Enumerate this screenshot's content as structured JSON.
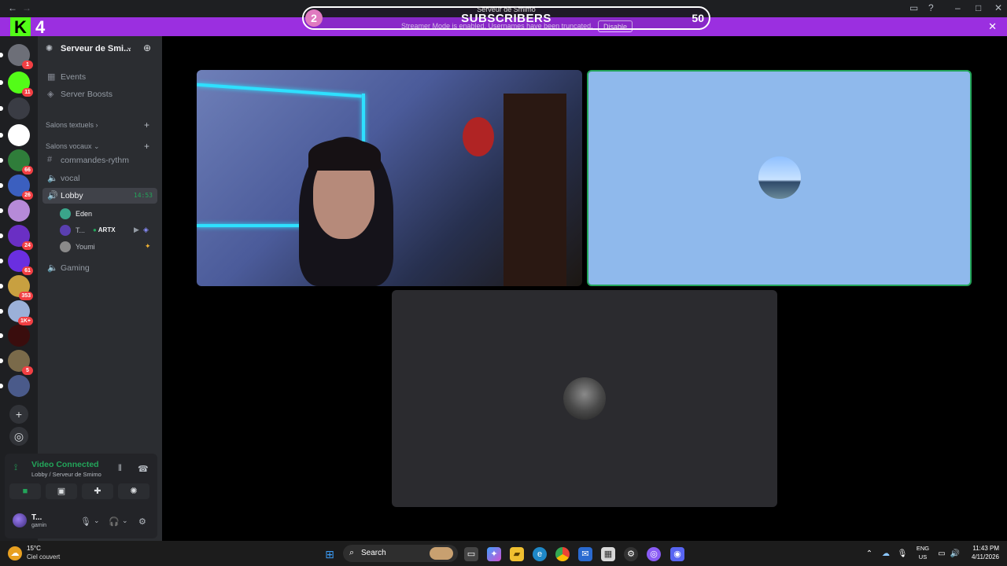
{
  "window": {
    "back_icon": "arrow-left-icon",
    "forward_icon": "arrow-right-icon"
  },
  "overlay": {
    "left_count": "2",
    "title": "SUBSCRIBERS",
    "server": "Serveur de Smimo",
    "right_count": "50"
  },
  "kick": {
    "logo": "K",
    "count": "4"
  },
  "banner": {
    "message": "Streamer Mode is enabled. Usernames have been truncated.",
    "disable": "Disable"
  },
  "servers": [
    {
      "badge": "1",
      "color": "#6d6f78"
    },
    {
      "badge": "11",
      "color": "#53fc18"
    },
    {
      "badge": "",
      "color": "#3a3c44"
    },
    {
      "badge": "",
      "color": "#ffffff"
    },
    {
      "badge": "66",
      "color": "#2f7d3a"
    },
    {
      "badge": "26",
      "color": "#3b5fbf"
    },
    {
      "badge": "",
      "color": "#b68ad8"
    },
    {
      "badge": "24",
      "color": "#6a2fc4"
    },
    {
      "badge": "61",
      "color": "#6a2fe0"
    },
    {
      "badge": "353",
      "color": "#c8a040"
    },
    {
      "badge": "1K+",
      "color": "#9bb0d8"
    },
    {
      "badge": "",
      "color": "#3a0d0d"
    },
    {
      "badge": "5",
      "color": "#7a6a4a"
    },
    {
      "badge": "",
      "color": "#4a5a8a"
    }
  ],
  "server_header": {
    "name": "Serveur de Smi..."
  },
  "channels": {
    "events": "Events",
    "boosts": "Server Boosts",
    "cat_text": "Salons textuels",
    "cat_voice": "Salons vocaux",
    "items": [
      {
        "label": "commandes-rythm",
        "icon": "#"
      },
      {
        "label": "vocal",
        "icon": "🔈"
      },
      {
        "label": "Lobby",
        "icon": "🔊",
        "time": "14:53"
      },
      {
        "label": "Gaming",
        "icon": "🔈"
      }
    ],
    "members": [
      {
        "name": "Eden",
        "color": "#3aa58a"
      },
      {
        "name": "T...",
        "color": "#5a3fb0",
        "tag": "ARTX"
      },
      {
        "name": "Youmi",
        "color": "#8a8a8a"
      }
    ]
  },
  "voice": {
    "status": "Video Connected",
    "location": "Lobby / Serveur de Smimo"
  },
  "user": {
    "name": "T...",
    "status": "gamin"
  },
  "taskbar": {
    "temp": "15°C",
    "weather": "Ciel couvert",
    "search": "Search",
    "lang1": "ENG",
    "lang2": "US",
    "time": "11:43 PM",
    "date": "4/11/2026"
  }
}
